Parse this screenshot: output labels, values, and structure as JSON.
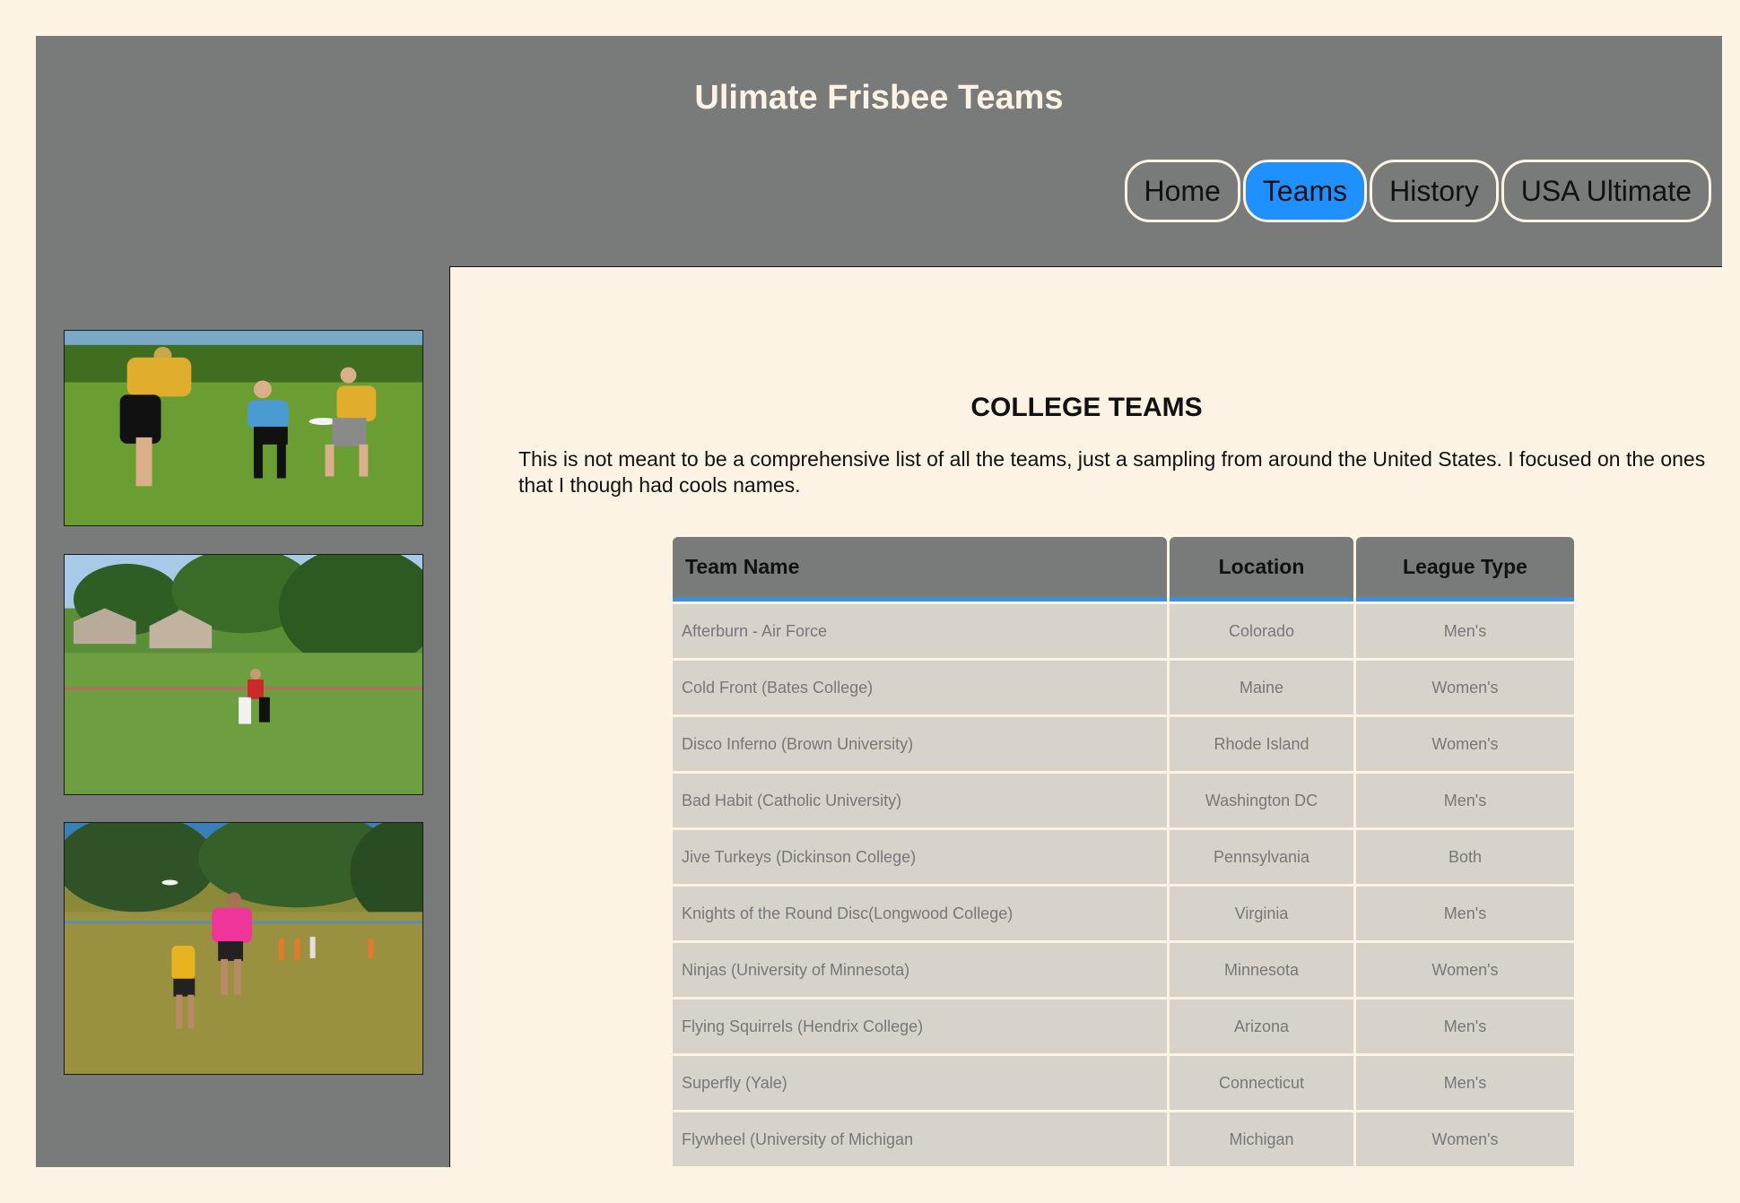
{
  "site": {
    "title": "Ulimate Frisbee Teams"
  },
  "nav": {
    "items": [
      {
        "label": "Home",
        "active": false
      },
      {
        "label": "Teams",
        "active": true
      },
      {
        "label": "History",
        "active": false
      },
      {
        "label": "USA Ultimate",
        "active": false
      }
    ]
  },
  "colors": {
    "page_background": "#fdf3e4",
    "frame_gray": "#797b7a",
    "active_nav": "#1e90ff",
    "table_header_underline": "#3d8fd8",
    "table_cell": "#d7d3cb"
  },
  "content": {
    "heading": "COLLEGE TEAMS",
    "intro": "This is not meant to be a comprehensive list of all the teams, just a sampling from around the United States. I focused on the ones that I though had cools names.",
    "table": {
      "headers": [
        "Team Name",
        "Location",
        "League Type"
      ],
      "rows": [
        [
          "Afterburn - Air Force",
          "Colorado",
          "Men's"
        ],
        [
          "Cold Front (Bates College)",
          "Maine",
          "Women's"
        ],
        [
          "Disco Inferno (Brown University)",
          "Rhode Island",
          "Women's"
        ],
        [
          "Bad Habit (Catholic University)",
          "Washington DC",
          "Men's"
        ],
        [
          "Jive Turkeys (Dickinson College)",
          "Pennsylvania",
          "Both"
        ],
        [
          "Knights of the Round Disc(Longwood College)",
          "Virginia",
          "Men's"
        ],
        [
          "Ninjas (University of Minnesota)",
          "Minnesota",
          "Women's"
        ],
        [
          "Flying Squirrels (Hendrix College)",
          "Arizona",
          "Men's"
        ],
        [
          "Superfly (Yale)",
          "Connecticut",
          "Men's"
        ],
        [
          "Flywheel (University of Michigan",
          "Michigan",
          "Women's"
        ]
      ]
    }
  }
}
